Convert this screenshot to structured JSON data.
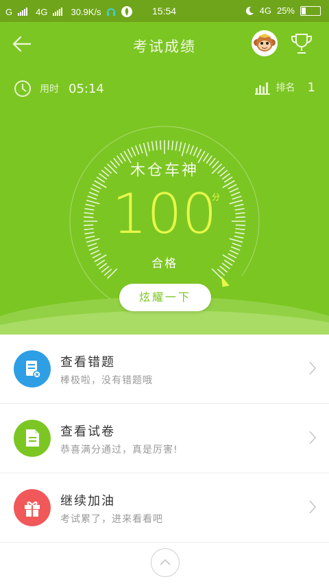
{
  "status_bar": {
    "carrier1": "G",
    "carrier2": "4G",
    "speed": "30.9K/s",
    "time": "15:54",
    "network": "4G",
    "battery": "25%"
  },
  "header": {
    "title": "考试成绩"
  },
  "stats": {
    "time_label": "用时",
    "time_value": "05:14",
    "rank_label": "排名",
    "rank_value": "1"
  },
  "result": {
    "name": "木仓车神",
    "score": 100,
    "unit": "分",
    "status": "合格",
    "share_button": "炫耀一下"
  },
  "menu": [
    {
      "title": "查看错题",
      "subtitle": "棒极啦，没有错题哦",
      "icon": "document-icon",
      "color": "#2e9ee5"
    },
    {
      "title": "查看试卷",
      "subtitle": "恭喜满分通过，真是厉害!",
      "icon": "paper-icon",
      "color": "#7cc623"
    },
    {
      "title": "继续加油",
      "subtitle": "考试累了，进来看看吧",
      "icon": "gift-icon",
      "color": "#f0585a"
    }
  ],
  "colors": {
    "hero_green": "#7cc623",
    "status_green": "#6fa51a",
    "score_yellow": "#e6f84a"
  }
}
